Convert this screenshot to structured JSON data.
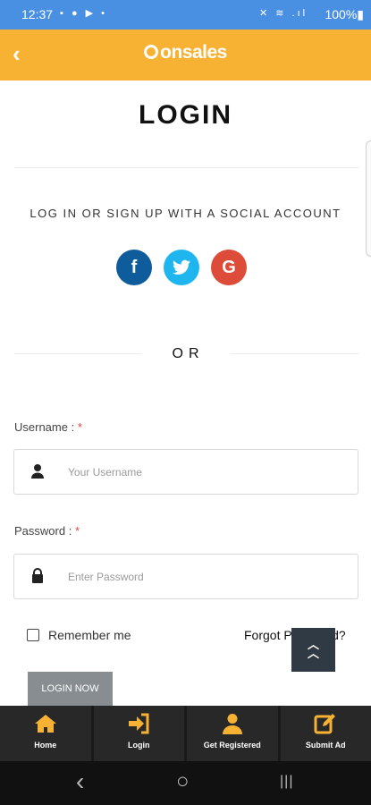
{
  "status_bar": {
    "time": "12:37",
    "left_icons": "▪ ● ▶ •",
    "right_icons": "✕ ≋ .ıl",
    "battery": "100%▮"
  },
  "app_bar": {
    "back_icon": "‹",
    "logo_text": "onsales",
    "accent_color": "#f7b233"
  },
  "page": {
    "title": "LOGIN",
    "social_caption": "LOG IN OR SIGN UP WITH A SOCIAL ACCOUNT",
    "social": [
      {
        "name": "facebook",
        "glyph": "f",
        "color": "#0f5c9c"
      },
      {
        "name": "twitter",
        "glyph": "🐦",
        "color": "#1fb6ef"
      },
      {
        "name": "google",
        "glyph": "G",
        "color": "#dd4b39"
      }
    ],
    "or_text": "OR"
  },
  "form": {
    "username_label": "Username :",
    "username_required": "*",
    "username_placeholder": "Your Username",
    "username_value": "",
    "password_label": "Password :",
    "password_required": "*",
    "password_placeholder": "Enter Password",
    "password_value": "",
    "remember_label": "Remember me",
    "remember_checked": false,
    "forgot_label": "Forgot P",
    "forgot_tail": "d?",
    "login_button": "LOGIN NOW"
  },
  "scroll_top_icon": "double-chevron-up-icon",
  "tab_bar": {
    "items": [
      {
        "label": "Home",
        "icon": "home-icon"
      },
      {
        "label": "Login",
        "icon": "login-icon"
      },
      {
        "label": "Get Registered",
        "icon": "user-icon"
      },
      {
        "label": "Submit Ad",
        "icon": "edit-icon"
      }
    ],
    "icon_color": "#f7b233"
  },
  "nav_bar": {
    "back": "‹",
    "home": "○",
    "recents": "|||"
  }
}
